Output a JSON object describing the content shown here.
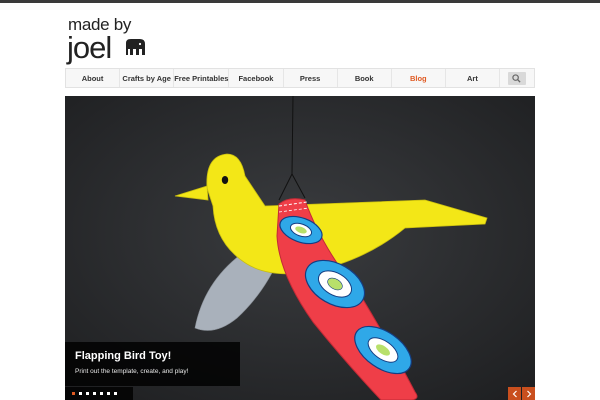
{
  "logo": {
    "line1": "made by",
    "line2": "joel"
  },
  "nav": {
    "items": [
      {
        "label": "About"
      },
      {
        "label": "Crafts by Age"
      },
      {
        "label": "Free Printables"
      },
      {
        "label": "Facebook"
      },
      {
        "label": "Press"
      },
      {
        "label": "Book"
      },
      {
        "label": "Blog",
        "active": true
      },
      {
        "label": "Art"
      }
    ],
    "search_icon": "search-icon"
  },
  "slider": {
    "title": "Flapping Bird Toy!",
    "text": "Print out the template, create, and play!",
    "slide_count": 7,
    "active_slide": 1
  },
  "colors": {
    "accent": "#e05a22",
    "nav_active": "#e05a22",
    "slide_background": "#262729",
    "caption_background": "#000000",
    "arrow_background": "#c94f1e"
  }
}
